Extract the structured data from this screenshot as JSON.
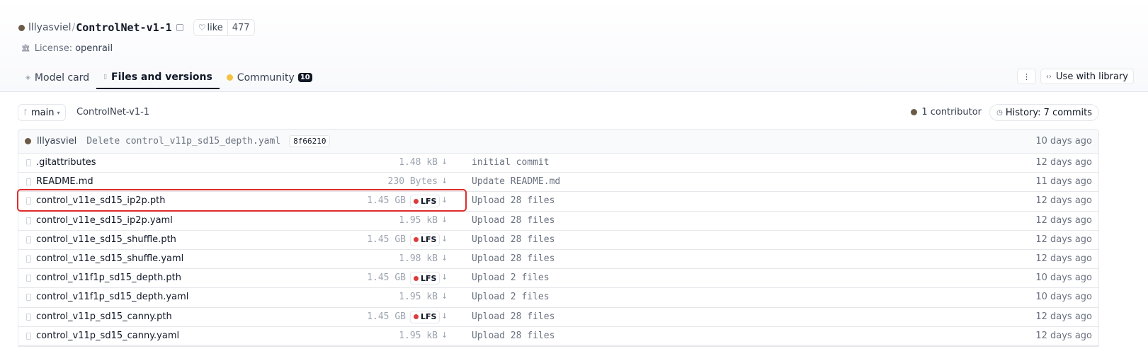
{
  "repo": {
    "owner": "lllyasviel",
    "separator": "/",
    "name": "ControlNet-v1-1",
    "like_label": "like",
    "like_count": "477"
  },
  "license": {
    "label": "License:",
    "value": "openrail"
  },
  "tabs": [
    {
      "label": "Model card",
      "active": false
    },
    {
      "label": "Files and versions",
      "active": true
    },
    {
      "label": "Community",
      "badge": "10",
      "active": false
    }
  ],
  "actions": {
    "more_label": "⋮",
    "use_with_library": "Use with library"
  },
  "branch": {
    "name": "main",
    "path": "ControlNet-v1-1"
  },
  "contributors": "1 contributor",
  "history": "History: 7 commits",
  "last_commit": {
    "author": "lllyasviel",
    "message": "Delete control_v11p_sd15_depth.yaml",
    "hash": "8f66210",
    "time": "10 days ago"
  },
  "files": [
    {
      "name": ".gitattributes",
      "size": "1.48 kB",
      "lfs": false,
      "message": "initial commit",
      "time": "12 days ago"
    },
    {
      "name": "README.md",
      "size": "230 Bytes",
      "lfs": false,
      "message": "Update README.md",
      "time": "11 days ago"
    },
    {
      "name": "control_v11e_sd15_ip2p.pth",
      "size": "1.45 GB",
      "lfs": true,
      "message": "Upload 28 files",
      "time": "12 days ago"
    },
    {
      "name": "control_v11e_sd15_ip2p.yaml",
      "size": "1.95 kB",
      "lfs": false,
      "message": "Upload 28 files",
      "time": "12 days ago"
    },
    {
      "name": "control_v11e_sd15_shuffle.pth",
      "size": "1.45 GB",
      "lfs": true,
      "message": "Upload 28 files",
      "time": "12 days ago"
    },
    {
      "name": "control_v11e_sd15_shuffle.yaml",
      "size": "1.98 kB",
      "lfs": false,
      "message": "Upload 28 files",
      "time": "12 days ago"
    },
    {
      "name": "control_v11f1p_sd15_depth.pth",
      "size": "1.45 GB",
      "lfs": true,
      "message": "Upload 2 files",
      "time": "10 days ago"
    },
    {
      "name": "control_v11f1p_sd15_depth.yaml",
      "size": "1.95 kB",
      "lfs": false,
      "message": "Upload 2 files",
      "time": "10 days ago"
    },
    {
      "name": "control_v11p_sd15_canny.pth",
      "size": "1.45 GB",
      "lfs": true,
      "message": "Upload 28 files",
      "time": "12 days ago"
    },
    {
      "name": "control_v11p_sd15_canny.yaml",
      "size": "1.95 kB",
      "lfs": false,
      "message": "Upload 28 files",
      "time": "12 days ago"
    }
  ],
  "lfs_label": "LFS",
  "download_glyph": "↓",
  "colors": {
    "highlight": "#e02b2b",
    "lfs_dot": "#dc3b3b",
    "community_dot": "#f5c242"
  },
  "icons": {
    "owner_avatar": "avatar",
    "copy": "copy-icon",
    "like": "heart-icon",
    "license": "bank-icon",
    "branch": "branch-icon",
    "history": "clock-icon",
    "file": "file-icon",
    "download": "download-icon"
  }
}
